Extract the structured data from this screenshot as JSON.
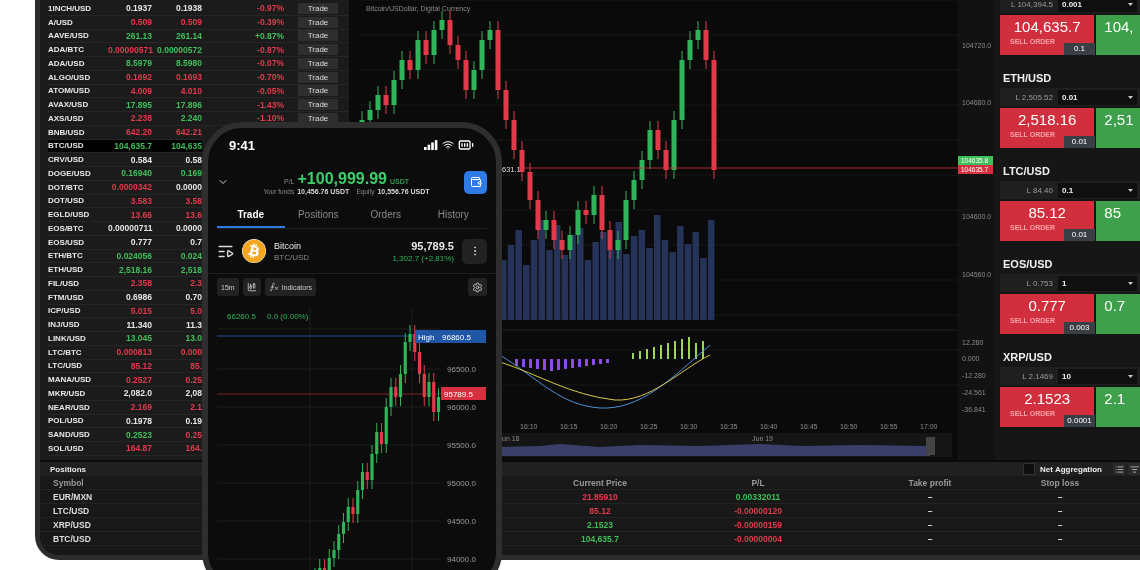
{
  "markets": {
    "rows": [
      {
        "pair": "1INCH/USD",
        "selected": false,
        "bid": {
          "text": "0.1937",
          "color": "#e6e6e6"
        },
        "ask": {
          "text": "0.1938",
          "color": "#e6e6e6"
        },
        "change": {
          "text": "-0.97%",
          "color": "#e23a4b"
        },
        "action": "Trade"
      },
      {
        "pair": "A/USD",
        "selected": false,
        "bid": {
          "text": "0.509",
          "color": "#e23a4b"
        },
        "ask": {
          "text": "0.509",
          "color": "#e23a4b"
        },
        "change": {
          "text": "-0.39%",
          "color": "#e23a4b"
        },
        "action": "Trade"
      },
      {
        "pair": "AAVE/USD",
        "selected": false,
        "bid": {
          "text": "261.13",
          "color": "#3fbf5a"
        },
        "ask": {
          "text": "261.14",
          "color": "#3fbf5a"
        },
        "change": {
          "text": "+0.87%",
          "color": "#3fbf5a"
        },
        "action": "Trade"
      },
      {
        "pair": "ADA/BTC",
        "selected": false,
        "bid": {
          "text": "0.00000571",
          "color": "#e23a4b"
        },
        "ask": {
          "text": "0.00000572",
          "color": "#3fbf5a"
        },
        "change": {
          "text": "-0.87%",
          "color": "#e23a4b"
        },
        "action": "Trade"
      },
      {
        "pair": "ADA/USD",
        "selected": false,
        "bid": {
          "text": "8.5979",
          "color": "#3fbf5a"
        },
        "ask": {
          "text": "8.5980",
          "color": "#3fbf5a"
        },
        "change": {
          "text": "-0.07%",
          "color": "#e23a4b"
        },
        "action": "Trade"
      },
      {
        "pair": "ALGO/USD",
        "selected": false,
        "bid": {
          "text": "0.1692",
          "color": "#e23a4b"
        },
        "ask": {
          "text": "0.1693",
          "color": "#e23a4b"
        },
        "change": {
          "text": "-0.70%",
          "color": "#e23a4b"
        },
        "action": "Trade"
      },
      {
        "pair": "ATOM/USD",
        "selected": false,
        "bid": {
          "text": "4.009",
          "color": "#e23a4b"
        },
        "ask": {
          "text": "4.010",
          "color": "#e23a4b"
        },
        "change": {
          "text": "-0.05%",
          "color": "#e23a4b"
        },
        "action": "Trade"
      },
      {
        "pair": "AVAX/USD",
        "selected": false,
        "bid": {
          "text": "17.895",
          "color": "#3fbf5a"
        },
        "ask": {
          "text": "17.896",
          "color": "#3fbf5a"
        },
        "change": {
          "text": "-1.43%",
          "color": "#e23a4b"
        },
        "action": "Trade"
      },
      {
        "pair": "AXS/USD",
        "selected": false,
        "bid": {
          "text": "2.238",
          "color": "#e23a4b"
        },
        "ask": {
          "text": "2.240",
          "color": "#3fbf5a"
        },
        "change": {
          "text": "-1.10%",
          "color": "#e23a4b"
        },
        "action": "Trade"
      },
      {
        "pair": "BNB/USD",
        "selected": false,
        "bid": {
          "text": "642.20",
          "color": "#e23a4b"
        },
        "ask": {
          "text": "642.21",
          "color": "#e23a4b"
        }
      },
      {
        "pair": "BTC/USD",
        "selected": true,
        "bid": {
          "text": "104,635.7",
          "color": "#3fbf5a"
        },
        "ask": {
          "text": "104,635",
          "color": "#3fbf5a"
        }
      },
      {
        "pair": "CRV/USD",
        "selected": false,
        "bid": {
          "text": "0.584",
          "color": "#e6e6e6"
        },
        "ask": {
          "text": "0.58",
          "color": "#e6e6e6"
        }
      },
      {
        "pair": "DOGE/USD",
        "selected": false,
        "bid": {
          "text": "0.16940",
          "color": "#3fbf5a"
        },
        "ask": {
          "text": "0.169",
          "color": "#3fbf5a"
        }
      },
      {
        "pair": "DOT/BTC",
        "selected": false,
        "bid": {
          "text": "0.0000342",
          "color": "#e23a4b"
        },
        "ask": {
          "text": "0.0000",
          "color": "#e6e6e6"
        }
      },
      {
        "pair": "DOT/USD",
        "selected": false,
        "bid": {
          "text": "3.583",
          "color": "#e23a4b"
        },
        "ask": {
          "text": "3.58",
          "color": "#e23a4b"
        }
      },
      {
        "pair": "EGLD/USD",
        "selected": false,
        "bid": {
          "text": "13.66",
          "color": "#e23a4b"
        },
        "ask": {
          "text": "13.6",
          "color": "#e23a4b"
        }
      },
      {
        "pair": "EOS/BTC",
        "selected": false,
        "bid": {
          "text": "0.00000711",
          "color": "#e6e6e6"
        },
        "ask": {
          "text": "0.0000",
          "color": "#e6e6e6"
        }
      },
      {
        "pair": "EOS/USD",
        "selected": false,
        "bid": {
          "text": "0.777",
          "color": "#e6e6e6"
        },
        "ask": {
          "text": "0.7",
          "color": "#e6e6e6"
        }
      },
      {
        "pair": "ETH/BTC",
        "selected": false,
        "bid": {
          "text": "0.024056",
          "color": "#3fbf5a"
        },
        "ask": {
          "text": "0.024",
          "color": "#3fbf5a"
        }
      },
      {
        "pair": "ETH/USD",
        "selected": false,
        "bid": {
          "text": "2,518.16",
          "color": "#3fbf5a"
        },
        "ask": {
          "text": "2,518",
          "color": "#3fbf5a"
        }
      },
      {
        "pair": "FIL/USD",
        "selected": false,
        "bid": {
          "text": "2.358",
          "color": "#e23a4b"
        },
        "ask": {
          "text": "2.3",
          "color": "#e23a4b"
        }
      },
      {
        "pair": "FTM/USD",
        "selected": false,
        "bid": {
          "text": "0.6986",
          "color": "#e6e6e6"
        },
        "ask": {
          "text": "0.70",
          "color": "#e6e6e6"
        }
      },
      {
        "pair": "ICP/USD",
        "selected": false,
        "bid": {
          "text": "5.015",
          "color": "#e23a4b"
        },
        "ask": {
          "text": "5.0",
          "color": "#e23a4b"
        }
      },
      {
        "pair": "INJ/USD",
        "selected": false,
        "bid": {
          "text": "11.340",
          "color": "#e6e6e6"
        },
        "ask": {
          "text": "11.3",
          "color": "#e6e6e6"
        }
      },
      {
        "pair": "LINK/USD",
        "selected": false,
        "bid": {
          "text": "13.045",
          "color": "#3fbf5a"
        },
        "ask": {
          "text": "13.0",
          "color": "#3fbf5a"
        }
      },
      {
        "pair": "LTC/BTC",
        "selected": false,
        "bid": {
          "text": "0.000813",
          "color": "#e23a4b"
        },
        "ask": {
          "text": "0.000",
          "color": "#e23a4b"
        }
      },
      {
        "pair": "LTC/USD",
        "selected": false,
        "bid": {
          "text": "85.12",
          "color": "#e23a4b"
        },
        "ask": {
          "text": "85.",
          "color": "#e23a4b"
        }
      },
      {
        "pair": "MANA/USD",
        "selected": false,
        "bid": {
          "text": "0.2527",
          "color": "#e23a4b"
        },
        "ask": {
          "text": "0.25",
          "color": "#e23a4b"
        }
      },
      {
        "pair": "MKR/USD",
        "selected": false,
        "bid": {
          "text": "2,082.0",
          "color": "#e6e6e6"
        },
        "ask": {
          "text": "2,08",
          "color": "#e6e6e6"
        }
      },
      {
        "pair": "NEAR/USD",
        "selected": false,
        "bid": {
          "text": "2.169",
          "color": "#e23a4b"
        },
        "ask": {
          "text": "2.1",
          "color": "#e23a4b"
        }
      },
      {
        "pair": "POL/USD",
        "selected": false,
        "bid": {
          "text": "0.1978",
          "color": "#e6e6e6"
        },
        "ask": {
          "text": "0.19",
          "color": "#e6e6e6"
        }
      },
      {
        "pair": "SAND/USD",
        "selected": false,
        "bid": {
          "text": "0.2523",
          "color": "#3fbf5a"
        },
        "ask": {
          "text": "0.25",
          "color": "#e23a4b"
        }
      },
      {
        "pair": "SOL/USD",
        "selected": false,
        "bid": {
          "text": "164.87",
          "color": "#e23a4b"
        },
        "ask": {
          "text": "164.",
          "color": "#e23a4b"
        }
      }
    ]
  },
  "chart": {
    "title": "Bitcoin/USDollar, Digital Currency",
    "line_label": "631.1",
    "price_ticks": [
      "104720.0",
      "104680.0",
      "104600.0",
      "104560.0"
    ],
    "last_labels": [
      {
        "text": "104635.8",
        "color": "#3fbf5a"
      },
      {
        "text": "104635.7",
        "color": "#d4303f"
      }
    ],
    "oscillator_ticks": [
      "12.280",
      "0.000",
      "-12.280",
      "-24.561",
      "-36.841"
    ],
    "time_ticks": [
      "16:10",
      "16:15",
      "16:20",
      "16:25",
      "16:30",
      "16:35",
      "16:40",
      "16:45",
      "16:50",
      "16:55",
      "17:00"
    ],
    "navigator_dates": [
      "un 18",
      "Jun 19"
    ]
  },
  "trade_panel": {
    "blocks": [
      {
        "limit": "L 104,394.5",
        "quantity": "0.001",
        "sell": "104,635.7",
        "sell_label": "SELL ORDER",
        "spread": "0.1",
        "buy": "104,"
      },
      {
        "pair": "ETH/USD",
        "limit": "L 2,505.52",
        "quantity": "0.01",
        "sell": "2,518.16",
        "sell_label": "SELL ORDER",
        "spread": "0.01",
        "buy": "2,51"
      },
      {
        "pair": "LTC/USD",
        "limit": "L 84.40",
        "quantity": "0.1",
        "sell": "85.12",
        "sell_label": "SELL ORDER",
        "spread": "0.01",
        "buy": "85"
      },
      {
        "pair": "EOS/USD",
        "limit": "L 0.753",
        "quantity": "1",
        "sell": "0.777",
        "sell_label": "SELL ORDER",
        "spread": "0.003",
        "buy": "0.7"
      },
      {
        "pair": "XRP/USD",
        "limit": "L 2.1469",
        "quantity": "10",
        "sell": "2.1523",
        "sell_label": "SELL ORDER",
        "spread": "0.0001",
        "buy": "2.1"
      }
    ]
  },
  "positions": {
    "title": "Positions",
    "net_aggregation": {
      "label": "Net Aggregation",
      "checked": false
    },
    "columns": [
      "Symbol",
      "Current Price",
      "P/L",
      "Take profit",
      "Stop loss"
    ],
    "rows": [
      {
        "symbol": "EUR/MXN",
        "price": {
          "text": "21.85910",
          "color": "#e23a4b"
        },
        "pl": {
          "text": "0.00332011",
          "color": "#3fbf5a"
        },
        "take_profit": "–",
        "stop_loss": "–"
      },
      {
        "symbol": "LTC/USD",
        "price": {
          "text": "85.12",
          "color": "#e23a4b"
        },
        "pl": {
          "text": "-0.00000120",
          "color": "#e23a4b"
        },
        "take_profit": "–",
        "stop_loss": "–"
      },
      {
        "symbol": "XRP/USD",
        "price": {
          "text": "2.1523",
          "color": "#3fbf5a"
        },
        "pl": {
          "text": "-0.00000159",
          "color": "#e23a4b"
        },
        "take_profit": "–",
        "stop_loss": "–"
      },
      {
        "symbol": "BTC/USD",
        "price": {
          "text": "104,635.7",
          "color": "#3fbf5a"
        },
        "pl": {
          "text": "-0.00000004",
          "color": "#e23a4b"
        },
        "take_profit": "–",
        "stop_loss": "–"
      }
    ]
  },
  "phone": {
    "time": "9:41",
    "pl_label": "P/L",
    "pl_value": "+100,999.99",
    "pl_unit": "USDT",
    "funds_label": "Your funds",
    "funds_value": "10,456.76 USDT",
    "equity_label": "Equity",
    "equity_value": "10,556.76 USDT",
    "tabs": [
      {
        "label": "Trade",
        "selected": true
      },
      {
        "label": "Positions",
        "selected": false
      },
      {
        "label": "Orders",
        "selected": false
      },
      {
        "label": "History",
        "selected": false
      }
    ],
    "instrument": {
      "name": "Bitcoin",
      "symbol": "BTC/USD",
      "price": "95,789.5",
      "change": "1,302.7 (+2,81%)"
    },
    "toolbar": {
      "interval": "15m",
      "indicators": "Indicators"
    },
    "chart": {
      "legend_price": "66260.5",
      "legend_change": "0.0 (0.00%)",
      "high_label": "High",
      "high_value": "96860.5",
      "last_price": "95789.5",
      "price_ticks": [
        "96500.0",
        "96000.0",
        "95500.0",
        "95000.0",
        "94500.0",
        "94000.0"
      ]
    }
  }
}
